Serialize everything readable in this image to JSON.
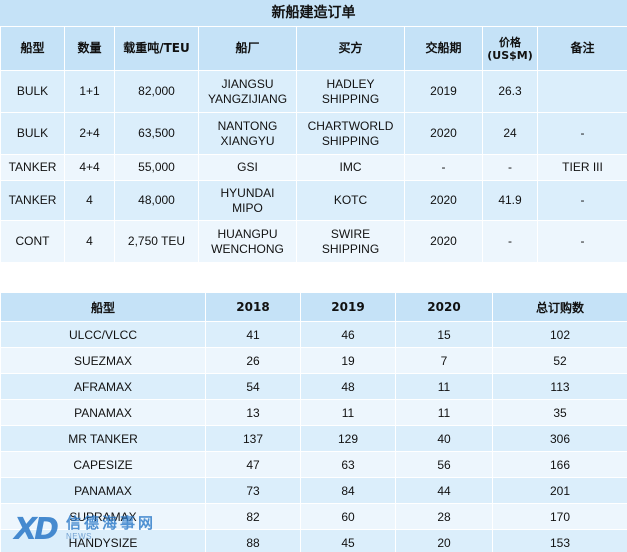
{
  "order_table": {
    "title": "新船建造订单",
    "headers": [
      "船型",
      "数量",
      "载重吨/TEU",
      "船厂",
      "买方",
      "交船期",
      "价格\n(US$M)",
      "备注"
    ],
    "rows": [
      [
        "BULK",
        "1+1",
        "82,000",
        "JIANGSU\nYANGZIJIANG",
        "HADLEY\nSHIPPING",
        "2019",
        "26.3",
        ""
      ],
      [
        "BULK",
        "2+4",
        "63,500",
        "NANTONG\nXIANGYU",
        "CHARTWORLD\nSHIPPING",
        "2020",
        "24",
        "-"
      ],
      [
        "TANKER",
        "4+4",
        "55,000",
        "GSI",
        "IMC",
        "-",
        "-",
        "TIER III"
      ],
      [
        "TANKER",
        "4",
        "48,000",
        "HYUNDAI\nMIPO",
        "KOTC",
        "2020",
        "41.9",
        "-"
      ],
      [
        "CONT",
        "4",
        "2,750 TEU",
        "HUANGPU\nWENCHONG",
        "SWIRE\nSHIPPING",
        "2020",
        "-",
        "-"
      ]
    ]
  },
  "summary_table": {
    "headers": [
      "船型",
      "2018",
      "2019",
      "2020",
      "总订购数"
    ],
    "rows": [
      [
        "ULCC/VLCC",
        "41",
        "46",
        "15",
        "102"
      ],
      [
        "SUEZMAX",
        "26",
        "19",
        "7",
        "52"
      ],
      [
        "AFRAMAX",
        "54",
        "48",
        "11",
        "113"
      ],
      [
        "PANAMAX",
        "13",
        "11",
        "11",
        "35"
      ],
      [
        "MR TANKER",
        "137",
        "129",
        "40",
        "306"
      ],
      [
        "CAPESIZE",
        "47",
        "63",
        "56",
        "166"
      ],
      [
        "PANAMAX",
        "73",
        "84",
        "44",
        "201"
      ],
      [
        "SUPRAMAX",
        "82",
        "60",
        "28",
        "170"
      ],
      [
        "HANDYSIZE",
        "88",
        "45",
        "20",
        "153"
      ]
    ]
  },
  "watermark": {
    "logo": "XD",
    "cn": "信德海事网",
    "en": "NEWS"
  }
}
